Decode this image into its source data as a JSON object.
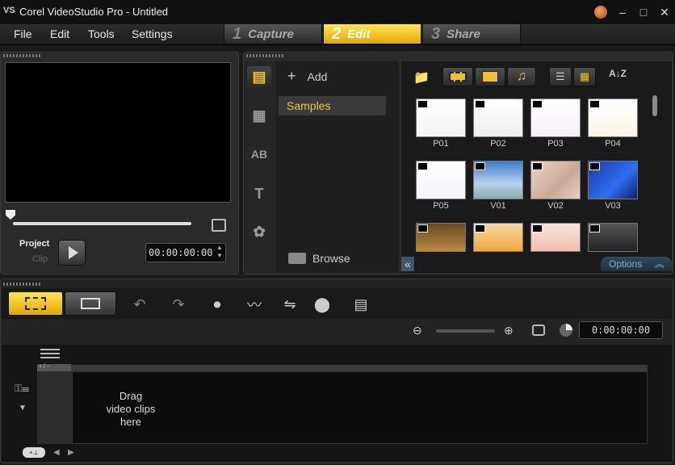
{
  "window": {
    "title": "Corel VideoStudio Pro - Untitled",
    "controls": [
      "minimize",
      "maximize",
      "close"
    ]
  },
  "menu": {
    "items": [
      "File",
      "Edit",
      "Tools",
      "Settings"
    ]
  },
  "steps": [
    {
      "num": "1",
      "label": "Capture",
      "active": false
    },
    {
      "num": "2",
      "label": "Edit",
      "active": true
    },
    {
      "num": "3",
      "label": "Share",
      "active": false
    }
  ],
  "player": {
    "project_label": "Project",
    "clip_label": "Clip",
    "timecode": "00:00:00:00"
  },
  "library": {
    "add_label": "Add",
    "folders": [
      "Samples"
    ],
    "browse_label": "Browse",
    "options_label": "Options",
    "sidebar_icons": [
      "media-icon",
      "transition-icon",
      "title-ab-icon",
      "text-icon",
      "graphic-icon"
    ],
    "thumbnails": [
      {
        "label": "P01",
        "kind": "photo"
      },
      {
        "label": "P02",
        "kind": "photo"
      },
      {
        "label": "P03",
        "kind": "photo"
      },
      {
        "label": "P04",
        "kind": "photo"
      },
      {
        "label": "P05",
        "kind": "photo"
      },
      {
        "label": "V01",
        "kind": "video"
      },
      {
        "label": "V02",
        "kind": "video"
      },
      {
        "label": "V03",
        "kind": "video"
      },
      {
        "label": "",
        "kind": "video"
      },
      {
        "label": "",
        "kind": "video"
      },
      {
        "label": "",
        "kind": "video"
      },
      {
        "label": "",
        "kind": "video"
      }
    ]
  },
  "timeline": {
    "timecode": "0:00:00:00",
    "drag_hint_lines": [
      "Drag",
      "video clips",
      "here"
    ],
    "track_tag": "+ / −"
  },
  "colors": {
    "accent": "#f2c531",
    "background": "#1a1a1a"
  }
}
